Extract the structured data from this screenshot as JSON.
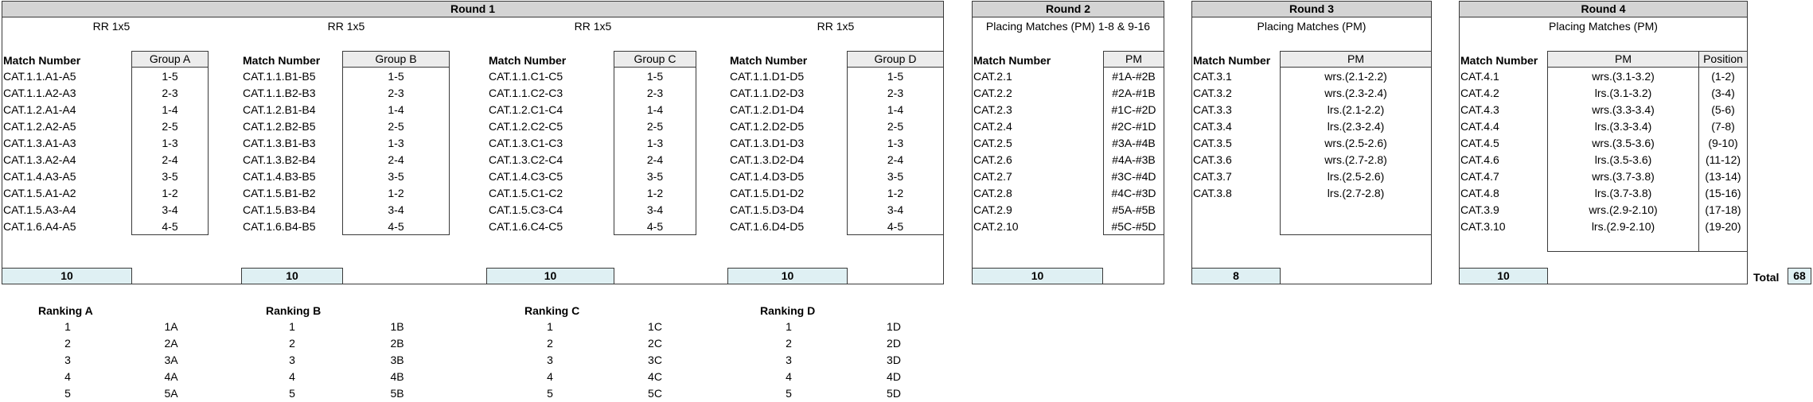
{
  "round1": {
    "title": "Round 1",
    "groups": [
      {
        "sub": "RR 1x5",
        "match_header": "Match Number",
        "group_header": "Group A",
        "matches": [
          "CAT.1.1.A1-A5",
          "CAT.1.1.A2-A3",
          "CAT.1.2.A1-A4",
          "CAT.1.2.A2-A5",
          "CAT.1.3.A1-A3",
          "CAT.1.3.A2-A4",
          "CAT.1.4.A3-A5",
          "CAT.1.5.A1-A2",
          "CAT.1.5.A3-A4",
          "CAT.1.6.A4-A5"
        ],
        "pairs": [
          "1-5",
          "2-3",
          "1-4",
          "2-5",
          "1-3",
          "2-4",
          "3-5",
          "1-2",
          "3-4",
          "4-5"
        ],
        "total": "10",
        "ranking_title": "Ranking A",
        "ranks": [
          "1",
          "2",
          "3",
          "4",
          "5"
        ],
        "codes": [
          "1A",
          "2A",
          "3A",
          "4A",
          "5A"
        ]
      },
      {
        "sub": "RR 1x5",
        "match_header": "Match Number",
        "group_header": "Group B",
        "matches": [
          "CAT.1.1.B1-B5",
          "CAT.1.1.B2-B3",
          "CAT.1.2.B1-B4",
          "CAT.1.2.B2-B5",
          "CAT.1.3.B1-B3",
          "CAT.1.3.B2-B4",
          "CAT.1.4.B3-B5",
          "CAT.1.5.B1-B2",
          "CAT.1.5.B3-B4",
          "CAT.1.6.B4-B5"
        ],
        "pairs": [
          "1-5",
          "2-3",
          "1-4",
          "2-5",
          "1-3",
          "2-4",
          "3-5",
          "1-2",
          "3-4",
          "4-5"
        ],
        "total": "10",
        "ranking_title": "Ranking B",
        "ranks": [
          "1",
          "2",
          "3",
          "4",
          "5"
        ],
        "codes": [
          "1B",
          "2B",
          "3B",
          "4B",
          "5B"
        ]
      },
      {
        "sub": "RR 1x5",
        "match_header": "Match Number",
        "group_header": "Group C",
        "matches": [
          "CAT.1.1.C1-C5",
          "CAT.1.1.C2-C3",
          "CAT.1.2.C1-C4",
          "CAT.1.2.C2-C5",
          "CAT.1.3.C1-C3",
          "CAT.1.3.C2-C4",
          "CAT.1.4.C3-C5",
          "CAT.1.5.C1-C2",
          "CAT.1.5.C3-C4",
          "CAT.1.6.C4-C5"
        ],
        "pairs": [
          "1-5",
          "2-3",
          "1-4",
          "2-5",
          "1-3",
          "2-4",
          "3-5",
          "1-2",
          "3-4",
          "4-5"
        ],
        "total": "10",
        "ranking_title": "Ranking C",
        "ranks": [
          "1",
          "2",
          "3",
          "4",
          "5"
        ],
        "codes": [
          "1C",
          "2C",
          "3C",
          "4C",
          "5C"
        ]
      },
      {
        "sub": "RR 1x5",
        "match_header": "Match Number",
        "group_header": "Group D",
        "matches": [
          "CAT.1.1.D1-D5",
          "CAT.1.1.D2-D3",
          "CAT.1.2.D1-D4",
          "CAT.1.2.D2-D5",
          "CAT.1.3.D1-D3",
          "CAT.1.3.D2-D4",
          "CAT.1.4.D3-D5",
          "CAT.1.5.D1-D2",
          "CAT.1.5.D3-D4",
          "CAT.1.6.D4-D5"
        ],
        "pairs": [
          "1-5",
          "2-3",
          "1-4",
          "2-5",
          "1-3",
          "2-4",
          "3-5",
          "1-2",
          "3-4",
          "4-5"
        ],
        "total": "10",
        "ranking_title": "Ranking D",
        "ranks": [
          "1",
          "2",
          "3",
          "4",
          "5"
        ],
        "codes": [
          "1D",
          "2D",
          "3D",
          "4D",
          "5D"
        ]
      }
    ]
  },
  "round2": {
    "title": "Round 2",
    "sub": "Placing Matches (PM) 1-8 & 9-16",
    "match_header": "Match Number",
    "pm_header": "PM",
    "matches": [
      "CAT.2.1",
      "CAT.2.2",
      "CAT.2.3",
      "CAT.2.4",
      "CAT.2.5",
      "CAT.2.6",
      "CAT.2.7",
      "CAT.2.8",
      "CAT.2.9",
      "CAT.2.10"
    ],
    "pm": [
      "#1A-#2B",
      "#2A-#1B",
      "#1C-#2D",
      "#2C-#1D",
      "#3A-#4B",
      "#4A-#3B",
      "#3C-#4D",
      "#4C-#3D",
      "#5A-#5B",
      "#5C-#5D"
    ],
    "total": "10"
  },
  "round3": {
    "title": "Round 3",
    "sub": "Placing Matches (PM)",
    "match_header": "Match Number",
    "pm_header": "PM",
    "matches": [
      "CAT.3.1",
      "CAT.3.2",
      "CAT.3.3",
      "CAT.3.4",
      "CAT.3.5",
      "CAT.3.6",
      "CAT.3.7",
      "CAT.3.8"
    ],
    "pm": [
      "wrs.(2.1-2.2)",
      "wrs.(2.3-2.4)",
      "lrs.(2.1-2.2)",
      "lrs.(2.3-2.4)",
      "wrs.(2.5-2.6)",
      "wrs.(2.7-2.8)",
      "lrs.(2.5-2.6)",
      "lrs.(2.7-2.8)"
    ],
    "total": "8"
  },
  "round4": {
    "title": "Round 4",
    "sub": "Placing Matches (PM)",
    "match_header": "Match Number",
    "pm_header": "PM",
    "position_header": "Position",
    "matches": [
      "CAT.4.1",
      "CAT.4.2",
      "CAT.4.3",
      "CAT.4.4",
      "CAT.4.5",
      "CAT.4.6",
      "CAT.4.7",
      "CAT.4.8",
      "CAT.3.9",
      "CAT.3.10"
    ],
    "pm": [
      "wrs.(3.1-3.2)",
      "lrs.(3.1-3.2)",
      "wrs.(3.3-3.4)",
      "lrs.(3.3-3.4)",
      "wrs.(3.5-3.6)",
      "lrs.(3.5-3.6)",
      "wrs.(3.7-3.8)",
      "lrs.(3.7-3.8)",
      "wrs.(2.9-2.10)",
      "lrs.(2.9-2.10)"
    ],
    "positions": [
      "(1-2)",
      "(3-4)",
      "(5-6)",
      "(7-8)",
      "(9-10)",
      "(11-12)",
      "(13-14)",
      "(15-16)",
      "(17-18)",
      "(19-20)"
    ],
    "total": "10"
  },
  "grand_total": {
    "label": "Total",
    "value": "68"
  }
}
